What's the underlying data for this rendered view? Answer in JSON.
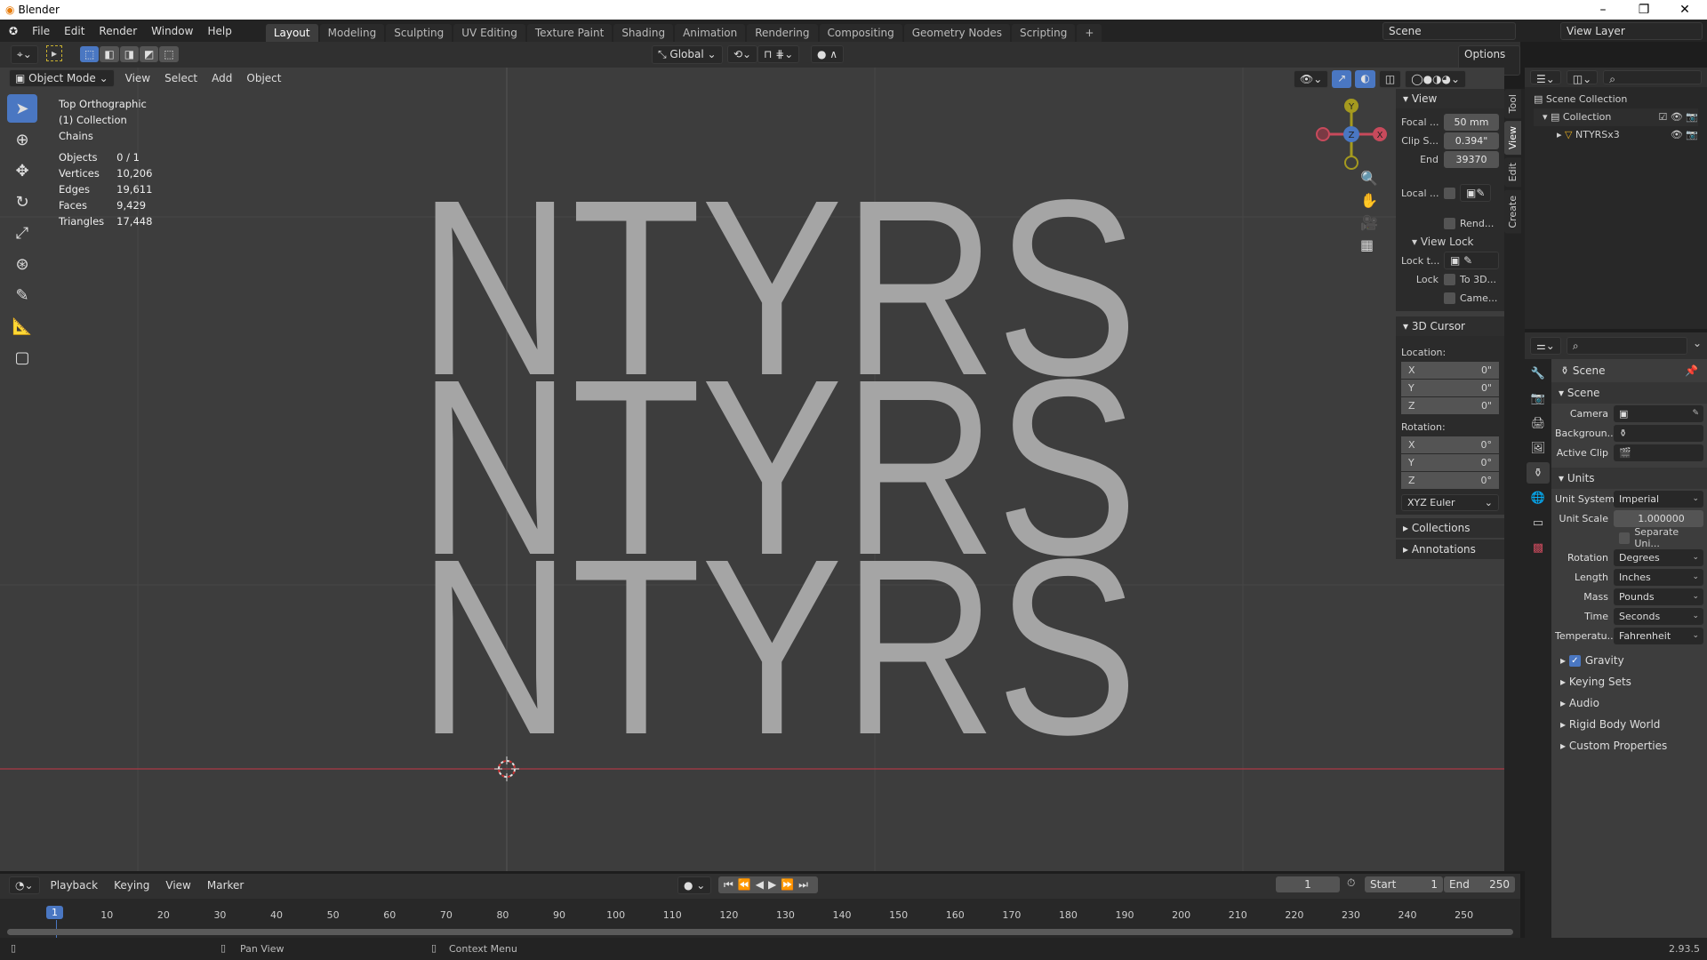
{
  "window": {
    "title": "Blender",
    "minimize": "–",
    "maximize": "❐",
    "close": "✕"
  },
  "menu": [
    "File",
    "Edit",
    "Render",
    "Window",
    "Help"
  ],
  "workspaces": [
    "Layout",
    "Modeling",
    "Sculpting",
    "UV Editing",
    "Texture Paint",
    "Shading",
    "Animation",
    "Rendering",
    "Compositing",
    "Geometry Nodes",
    "Scripting",
    "+"
  ],
  "active_workspace": "Layout",
  "scene_field": "Scene",
  "view_layer_field": "View Layer",
  "toolheader": {
    "orientation": "Global",
    "options": "Options"
  },
  "viewport": {
    "mode": "Object Mode",
    "menus": [
      "View",
      "Select",
      "Add",
      "Object"
    ],
    "view_name": "Top Orthographic",
    "collection": "(1) Collection",
    "object": "Chains",
    "stats": [
      [
        "Objects",
        "0 / 1"
      ],
      [
        "Vertices",
        "10,206"
      ],
      [
        "Edges",
        "19,611"
      ],
      [
        "Faces",
        "9,429"
      ],
      [
        "Triangles",
        "17,448"
      ]
    ],
    "text_rows": [
      "NTYRS",
      "NTYRS",
      "NTYRS"
    ],
    "text_color": "#a5a5a5",
    "gizmo": {
      "y": "Y",
      "z": "Z",
      "x": "X"
    }
  },
  "npanel": {
    "tabs": [
      "Tool",
      "View",
      "Edit",
      "Create"
    ],
    "active_tab": "View",
    "view": {
      "title": "View",
      "focal_label": "Focal ...",
      "focal": "50 mm",
      "clip_start_label": "Clip S...",
      "clip_start": "0.394\"",
      "end_label": "End",
      "end": "39370",
      "local_label": "Local ...",
      "render_label": "Rend..."
    },
    "view_lock": {
      "title": "View Lock",
      "lock_to_label": "Lock t...",
      "lock_label": "Lock",
      "to3d": "To 3D...",
      "camera": "Came..."
    },
    "cursor": {
      "title": "3D Cursor",
      "location": "Location:",
      "rotation": "Rotation:",
      "loc": [
        [
          "X",
          "0\""
        ],
        [
          "Y",
          "0\""
        ],
        [
          "Z",
          "0\""
        ]
      ],
      "rot": [
        [
          "X",
          "0°"
        ],
        [
          "Y",
          "0°"
        ],
        [
          "Z",
          "0°"
        ]
      ],
      "mode": "XYZ Euler"
    },
    "collections": "Collections",
    "annotations": "Annotations"
  },
  "outliner": {
    "scene_collection": "Scene Collection",
    "collection": "Collection",
    "object": "NTYRSx3"
  },
  "properties": {
    "header": "Scene",
    "scene": {
      "title": "Scene",
      "camera": "Camera",
      "background": "Backgroun...",
      "active_clip": "Active Clip"
    },
    "units": {
      "title": "Units",
      "rows": [
        [
          "Unit System",
          "Imperial"
        ],
        [
          "Unit Scale",
          "1.000000"
        ]
      ],
      "separate": "Separate Uni...",
      "selects": [
        [
          "Rotation",
          "Degrees"
        ],
        [
          "Length",
          "Inches"
        ],
        [
          "Mass",
          "Pounds"
        ],
        [
          "Time",
          "Seconds"
        ],
        [
          "Temperatu...",
          "Fahrenheit"
        ]
      ]
    },
    "collapsed": [
      "Gravity",
      "Keying Sets",
      "Audio",
      "Rigid Body World",
      "Custom Properties"
    ]
  },
  "timeline": {
    "menus": [
      "Playback",
      "Keying",
      "View",
      "Marker"
    ],
    "current_frame": "1",
    "start_label": "Start",
    "start": "1",
    "end_label": "End",
    "end": "250",
    "ticks": [
      "10",
      "20",
      "30",
      "40",
      "50",
      "60",
      "70",
      "80",
      "90",
      "100",
      "110",
      "120",
      "130",
      "140",
      "150",
      "160",
      "170",
      "180",
      "190",
      "200",
      "210",
      "220",
      "230",
      "240",
      "250"
    ]
  },
  "status": {
    "pan": "Pan View",
    "context": "Context Menu",
    "version": "2.93.5"
  }
}
